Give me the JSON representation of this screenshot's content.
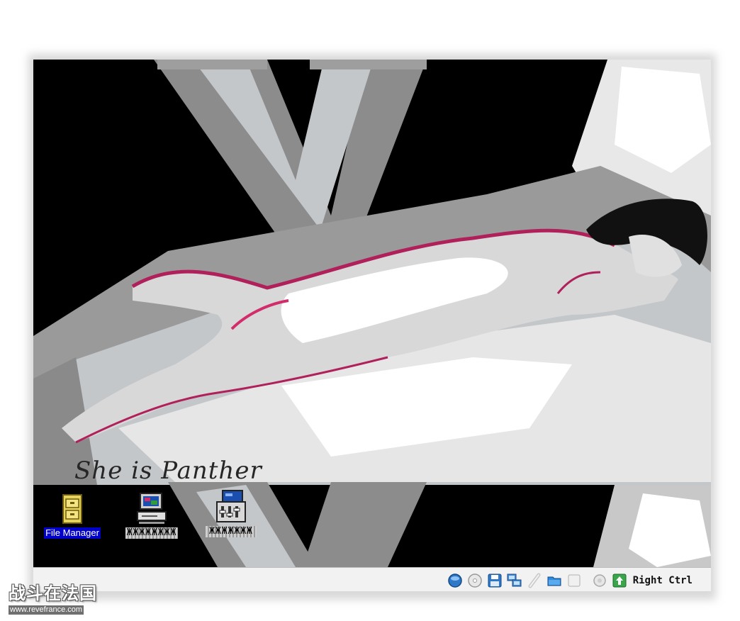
{
  "wallpaper": {
    "signature_text": "She is Panther"
  },
  "desktop_icons": [
    {
      "label": "File Manager",
      "icon": "file-cabinet-icon",
      "selected": true
    },
    {
      "label": "ЖЖЖЖЖЖЖЖ",
      "icon": "computer-icon",
      "selected": false
    },
    {
      "label": "ЖЖЖЖЖЖЖ",
      "icon": "control-panel-icon",
      "selected": false
    }
  ],
  "statusbar": {
    "host_key": "Right Ctrl",
    "tray_icons": [
      "hard-disk-icon",
      "optical-drive-icon",
      "floppy-icon",
      "network-icon",
      "usb-icon",
      "shared-folder-icon",
      "display-icon",
      "capture-icon",
      "keyboard-capture-icon"
    ]
  },
  "watermark": {
    "title": "战斗在法国",
    "url": "www.revefrance.com"
  },
  "colors": {
    "desktop_bg": "#000000",
    "selection": "#0000c8",
    "accent_magenta": "#b0205a",
    "statusbar_bg": "#f2f2f2"
  }
}
